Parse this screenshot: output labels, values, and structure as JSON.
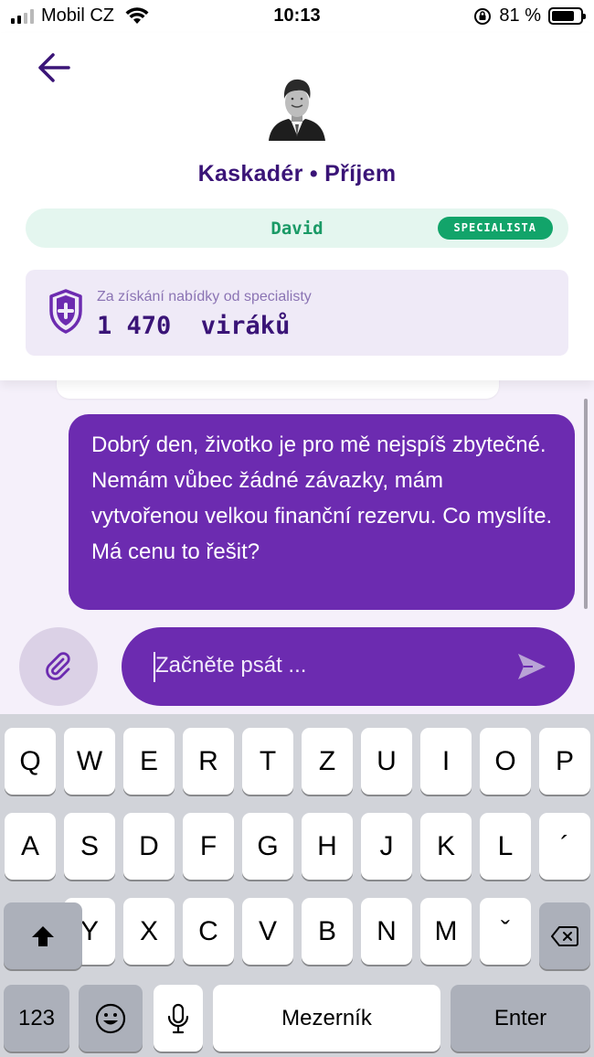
{
  "status_bar": {
    "carrier": "Mobil CZ",
    "time": "10:13",
    "battery_percent": "81 %",
    "battery_level": 0.81
  },
  "header": {
    "title": "Kaskadér • Příjem",
    "specialist": {
      "name": "David",
      "badge": "SPECIALISTA"
    },
    "reward": {
      "label": "Za získání nabídky od specialisty",
      "amount": "1 470  viráků"
    }
  },
  "chat": {
    "messages": [
      {
        "sender": "user",
        "text": "Dobrý den, životko je pro mě nejspíš zbytečné. Nemám vůbec žádné závazky, mám vytvořenou velkou finanční rezervu. Co myslíte. Má cenu to řešit?"
      }
    ],
    "input": {
      "placeholder": "Začněte psát ..."
    }
  },
  "keyboard": {
    "row1": [
      "Q",
      "W",
      "E",
      "R",
      "T",
      "Z",
      "U",
      "I",
      "O",
      "P"
    ],
    "row2": [
      "A",
      "S",
      "D",
      "F",
      "G",
      "H",
      "J",
      "K",
      "L",
      "´"
    ],
    "row3": [
      "Y",
      "X",
      "C",
      "V",
      "B",
      "N",
      "M",
      "ˇ"
    ],
    "numbers_label": "123",
    "space_label": "Mezerník",
    "enter_label": "Enter"
  },
  "colors": {
    "brand": "#6c2bb0",
    "title": "#3a1477",
    "specialist_green": "#12a46a",
    "chat_bg": "#f5f0fa"
  }
}
